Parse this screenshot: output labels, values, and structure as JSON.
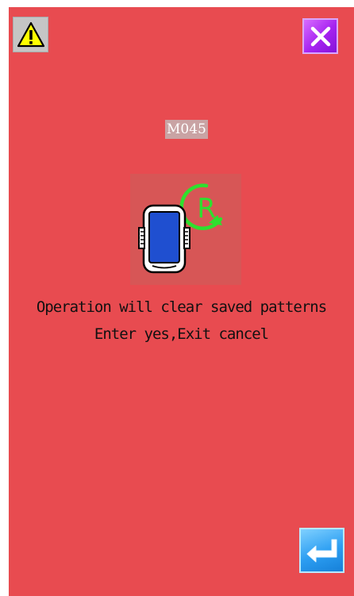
{
  "dialog": {
    "code": "M045",
    "message_line1": "Operation will clear saved patterns",
    "message_line2": "Enter yes,Exit cancel"
  },
  "icons": {
    "warning": "warning-triangle-icon",
    "close": "close-x-icon",
    "device_reset": "device-reset-icon",
    "enter": "enter-return-icon"
  },
  "colors": {
    "background": "#e84b50",
    "close_button": "#a623f0",
    "enter_button": "#2c9ef2",
    "reset_symbol": "#2ee02e",
    "device_screen": "#1f4fd0"
  }
}
